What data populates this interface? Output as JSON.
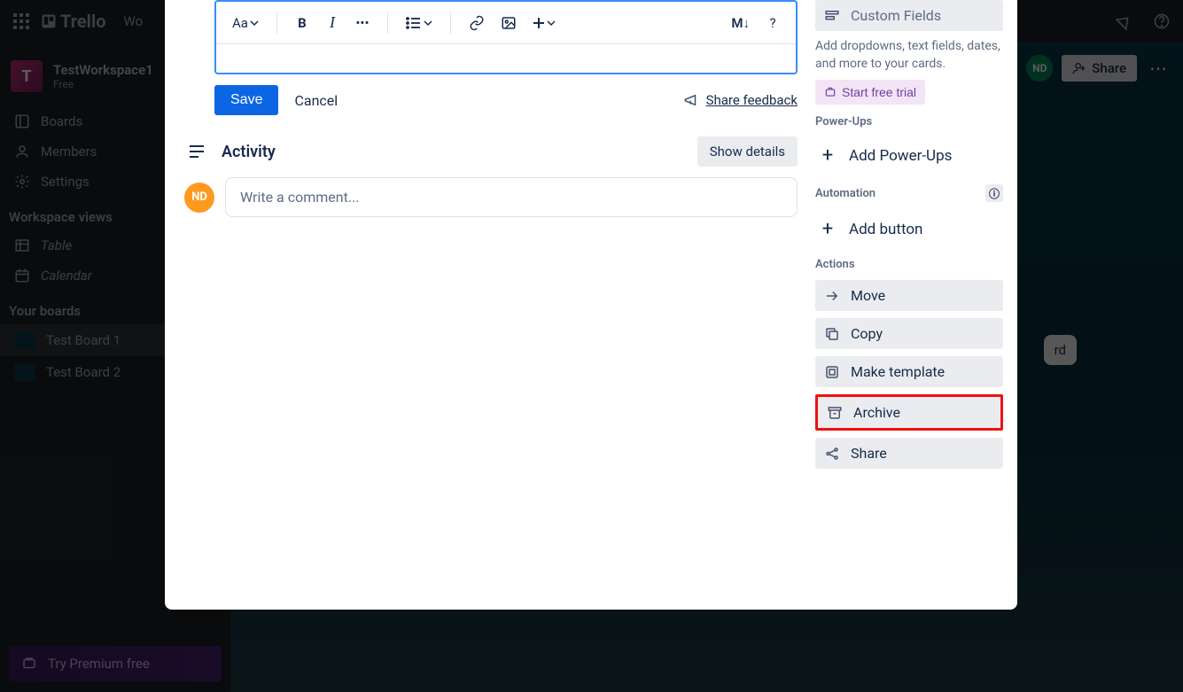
{
  "topbar": {
    "logo": "Trello",
    "menu_workspaces": "Wo"
  },
  "sidebar": {
    "workspace_initial": "T",
    "workspace_name": "TestWorkspace1",
    "workspace_plan": "Free",
    "nav": {
      "boards": "Boards",
      "members": "Members",
      "settings": "Settings"
    },
    "views_label": "Workspace views",
    "views": {
      "table": "Table",
      "calendar": "Calendar"
    },
    "your_boards_label": "Your boards",
    "boards": [
      "Test Board 1",
      "Test Board 2"
    ],
    "premium": "Try Premium free"
  },
  "board": {
    "avatar": "ND",
    "share": "Share",
    "bg_card_fragment": "rd"
  },
  "modal": {
    "toolbar": {
      "text_style": "Aa",
      "bold": "B",
      "italic": "I",
      "more": "•••",
      "markdown": "M↓",
      "help": "?"
    },
    "save": "Save",
    "cancel": "Cancel",
    "share_feedback": "Share feedback",
    "activity": "Activity",
    "show_details": "Show details",
    "avatar": "ND",
    "comment_placeholder": "Write a comment..."
  },
  "side": {
    "custom_fields": "Custom Fields",
    "custom_fields_desc": "Add dropdowns, text fields, dates, and more to your cards.",
    "trial": "Start free trial",
    "powerups_label": "Power-Ups",
    "add_powerups": "Add Power-Ups",
    "automation_label": "Automation",
    "add_button": "Add button",
    "actions_label": "Actions",
    "move": "Move",
    "copy": "Copy",
    "template": "Make template",
    "archive": "Archive",
    "share": "Share"
  }
}
